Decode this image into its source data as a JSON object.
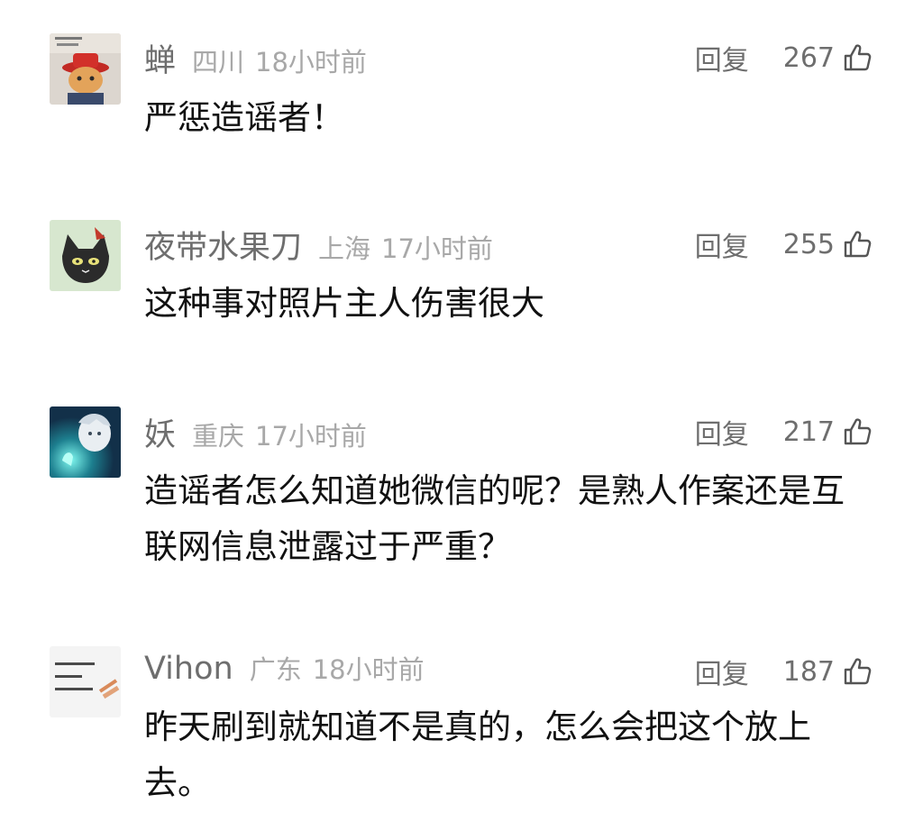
{
  "comments": [
    {
      "username": "蝉",
      "location": "四川",
      "time": "18小时前",
      "reply_label": "回复",
      "likes": "267",
      "content": "严惩造谣者！",
      "avatar_icon": "cartoon-cat-red-hat-avatar"
    },
    {
      "username": "夜带水果刀",
      "location": "上海",
      "time": "17小时前",
      "reply_label": "回复",
      "likes": "255",
      "content": "这种事对照片主人伤害很大",
      "avatar_icon": "black-cat-avatar"
    },
    {
      "username": "妖",
      "location": "重庆",
      "time": "17小时前",
      "reply_label": "回复",
      "likes": "217",
      "content": "造谣者怎么知道她微信的呢？是熟人作案还是互联网信息泄露过于严重？",
      "avatar_icon": "anime-glow-hand-avatar"
    },
    {
      "username": "Vihon",
      "location": "广东",
      "time": "18小时前",
      "reply_label": "回复",
      "likes": "187",
      "content": "昨天刷到就知道不是真的，怎么会把这个放上去。",
      "avatar_icon": "handwritten-note-avatar"
    }
  ],
  "colors": {
    "background": "#ffffff",
    "username": "#6e6e6e",
    "meta": "#a8a8a8",
    "content": "#111111"
  }
}
